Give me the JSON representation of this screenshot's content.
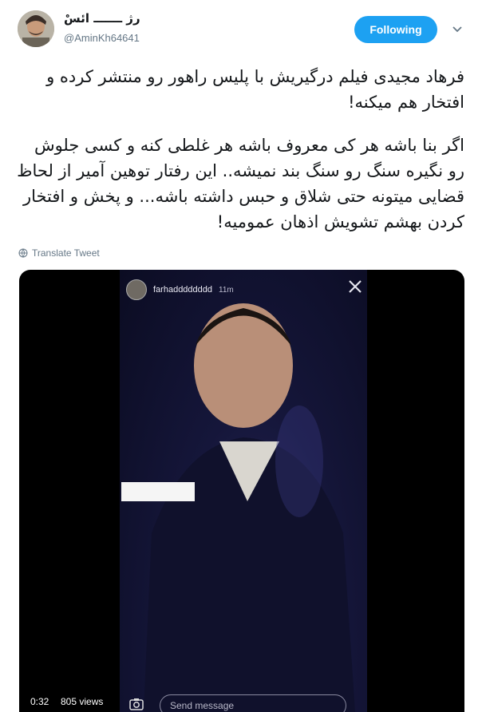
{
  "header": {
    "display_name": "رژ ـــــــ ائسْ",
    "handle": "@AminKh64641",
    "follow_label": "Following",
    "accent_color": "#1da1f2"
  },
  "tweet": {
    "paragraphs": [
      "فرهاد مجیدی فیلم درگیریش با پلیس راهور رو منتشر کرده و افتخار هم میکنه!",
      "اگر بنا باشه هر کی معروف باشه هر غلطی کنه و کسی جلوش رو نگیره سنگ رو سنگ بند نمیشه.. این رفتار توهین آمیر از لحاظ قضایی میتونه حتی شلاق و حبس داشته باشه... و پخش و افتخار کردن بهشم تشویش اذهان عمومیه!"
    ],
    "translate_label": "Translate Tweet"
  },
  "media": {
    "story_user": "farhadddddddd",
    "story_time": "11m",
    "send_message_placeholder": "Send message",
    "duration": "0:32",
    "views": "805 views"
  },
  "icons": {
    "chevron": "chevron-down-icon",
    "globe": "globe-icon",
    "close": "close-icon",
    "camera": "camera-icon"
  }
}
